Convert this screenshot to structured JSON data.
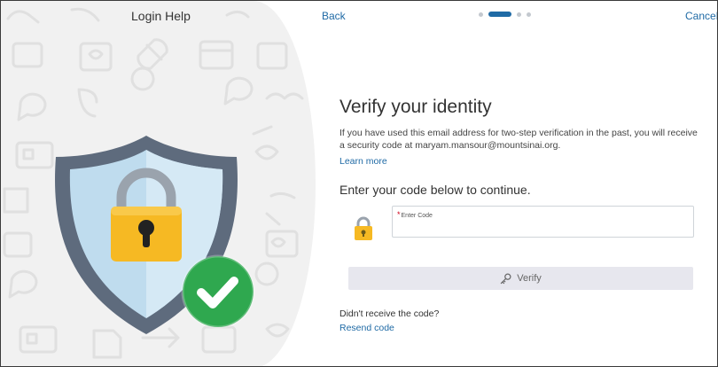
{
  "left": {
    "title": "Login Help",
    "shield_icon": "shield-lock-icon",
    "check_icon": "check-circle-icon"
  },
  "nav": {
    "back_label": "Back",
    "cancel_label": "Cancel",
    "steps_total": 4,
    "steps_current": 2
  },
  "main": {
    "heading": "Verify your identity",
    "description": "If you have used this email address for two-step verification in the past, you will receive a security code at maryam.mansour@mountsinai.org.",
    "learn_more": "Learn more",
    "sub_heading": "Enter your code below to continue.",
    "code_field": {
      "required_mark": "*",
      "label": "Enter Code",
      "value": ""
    },
    "verify_label": "Verify",
    "no_code_text": "Didn't receive the code?",
    "resend_label": "Resend code"
  },
  "colors": {
    "link": "#1f6aa5",
    "shield_outer": "#5e6b7d",
    "shield_inner": "#bfdcee",
    "lock_body": "#f6b923",
    "check_green": "#2fa84f",
    "required": "#d0021b"
  }
}
